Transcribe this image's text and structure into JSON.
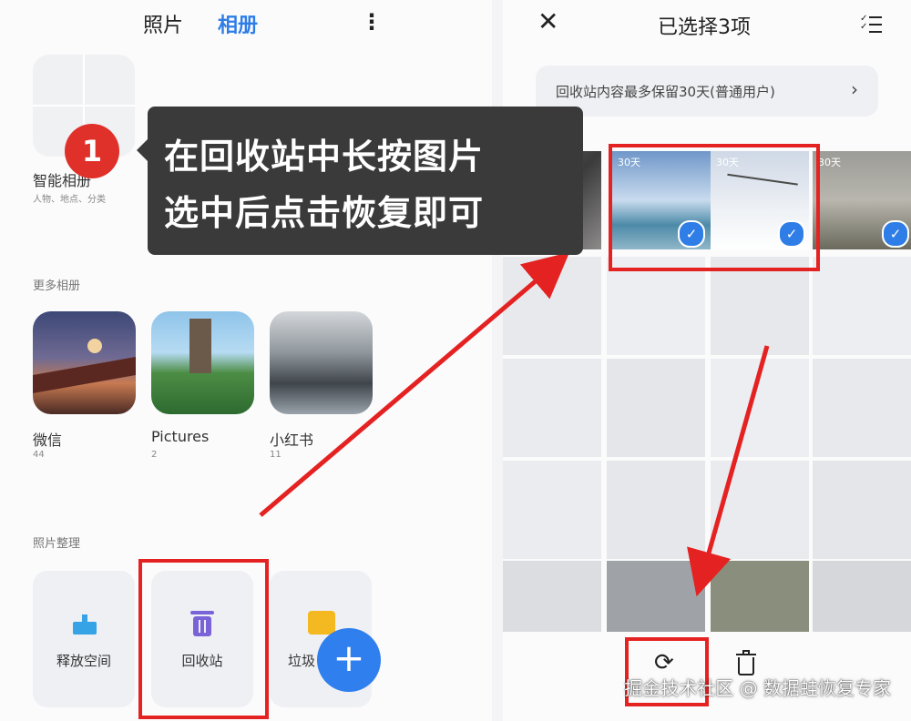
{
  "left": {
    "tabs": [
      {
        "label": "照片"
      },
      {
        "label": "相册"
      }
    ],
    "smart_album": {
      "name": "智能相册",
      "subtitle": "人物、地点、分类"
    },
    "more_albums_title": "更多相册",
    "albums": [
      {
        "name": "微信",
        "count": "44"
      },
      {
        "name": "Pictures",
        "count": "2"
      },
      {
        "name": "小红书",
        "count": "11"
      }
    ],
    "organize_title": "照片整理",
    "tools": [
      {
        "label": "释放空间",
        "icon": "broom-icon"
      },
      {
        "label": "回收站",
        "icon": "trash-icon"
      },
      {
        "label": "垃圾",
        "icon": "folder-icon"
      }
    ]
  },
  "tooltip": {
    "step": "1",
    "line1": "在回收站中长按图片",
    "line2": "选中后点击恢复即可"
  },
  "right": {
    "title": "已选择3项",
    "notice": "回收站内容最多保留30天(普通用户)",
    "thumb_label": "30天"
  },
  "watermark": "掘金技术社区 @ 数据蛙恢复专家",
  "colors": {
    "accent": "#2f7de7",
    "highlight": "#e52222"
  }
}
